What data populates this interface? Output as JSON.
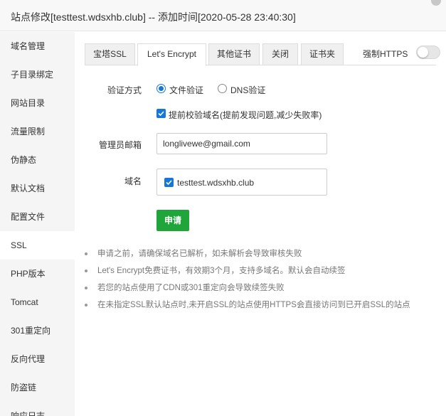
{
  "window": {
    "title": "站点修改[testtest.wdsxhb.club] -- 添加时间[2020-05-28 23:40:30]"
  },
  "sidebar": {
    "items": [
      {
        "label": "域名管理"
      },
      {
        "label": "子目录绑定"
      },
      {
        "label": "网站目录"
      },
      {
        "label": "流量限制"
      },
      {
        "label": "伪静态"
      },
      {
        "label": "默认文档"
      },
      {
        "label": "配置文件"
      },
      {
        "label": "SSL"
      },
      {
        "label": "PHP版本"
      },
      {
        "label": "Tomcat"
      },
      {
        "label": "301重定向"
      },
      {
        "label": "反向代理"
      },
      {
        "label": "防盗链"
      },
      {
        "label": "响应日志"
      }
    ],
    "active_index": 7
  },
  "tabs": {
    "items": [
      {
        "label": "宝塔SSL"
      },
      {
        "label": "Let's Encrypt"
      },
      {
        "label": "其他证书"
      },
      {
        "label": "关闭"
      },
      {
        "label": "证书夹"
      }
    ],
    "active_index": 1
  },
  "force_https": {
    "label": "强制HTTPS",
    "enabled": false
  },
  "form": {
    "verify_label": "验证方式",
    "verify_options": [
      {
        "label": "文件验证",
        "checked": true
      },
      {
        "label": "DNS验证",
        "checked": false
      }
    ],
    "precheck_label": "提前校验域名(提前发现问题,减少失败率)",
    "precheck_checked": true,
    "email_label": "管理员邮箱",
    "email_value": "longlivewe@gmail.com",
    "domain_label": "域名",
    "domain_option": "testtest.wdsxhb.club",
    "domain_checked": true,
    "apply_label": "申请"
  },
  "tips": [
    "申请之前，请确保域名已解析，如未解析会导致审核失败",
    "Let's Encrypt免费证书，有效期3个月，支持多域名。默认会自动续签",
    "若您的站点使用了CDN或301重定向会导致续签失败",
    "在未指定SSL默认站点时,未开启SSL的站点使用HTTPS会直接访问到已开启SSL的站点"
  ],
  "colors": {
    "accent_blue": "#1677d9",
    "apply_green": "#20a53a",
    "sidebar_bg": "#f5f5f5"
  }
}
